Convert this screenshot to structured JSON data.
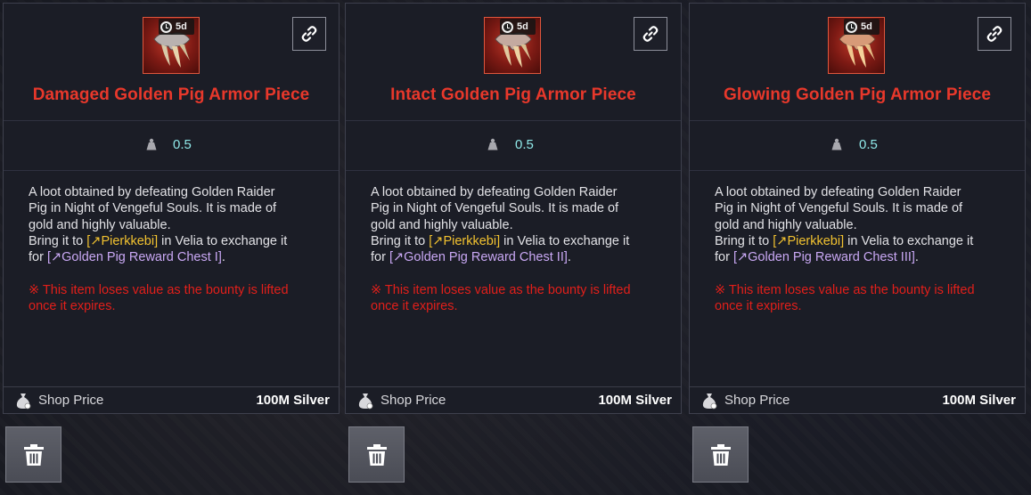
{
  "items": [
    {
      "timer": "5d",
      "title": "Damaged Golden Pig Armor Piece",
      "weight": "0.5",
      "desc_line1": "A loot obtained by defeating Golden Raider",
      "desc_line2": "Pig in Night of Vengeful Souls. It is made of",
      "desc_line3": "gold and highly valuable.",
      "desc_bring_prefix": "Bring it to ",
      "npc_name": "[↗Pierkkebi]",
      "desc_bring_suffix": " in Velia to exchange it",
      "desc_for": "for ",
      "reward_name": "[↗Golden Pig Reward Chest I]",
      "desc_end": ".",
      "warning_line1": "※ This item loses value as the bounty is lifted",
      "warning_line2": "once it expires.",
      "price_label": "Shop Price",
      "price_value": "100M Silver"
    },
    {
      "timer": "5d",
      "title": "Intact Golden Pig Armor Piece",
      "weight": "0.5",
      "desc_line1": "A loot obtained by defeating Golden Raider",
      "desc_line2": "Pig in Night of Vengeful Souls. It is made of",
      "desc_line3": "gold and highly valuable.",
      "desc_bring_prefix": "Bring it to ",
      "npc_name": "[↗Pierkkebi]",
      "desc_bring_suffix": " in Velia to exchange it",
      "desc_for": "for ",
      "reward_name": "[↗Golden Pig Reward Chest II]",
      "desc_end": ".",
      "warning_line1": "※ This item loses value as the bounty is lifted",
      "warning_line2": "once it expires.",
      "price_label": "Shop Price",
      "price_value": "100M Silver"
    },
    {
      "timer": "5d",
      "title": "Glowing Golden Pig Armor Piece",
      "weight": "0.5",
      "desc_line1": "A loot obtained by defeating Golden Raider",
      "desc_line2": "Pig in Night of Vengeful Souls. It is made of",
      "desc_line3": "gold and highly valuable.",
      "desc_bring_prefix": "Bring it to ",
      "npc_name": "[↗Pierkkebi]",
      "desc_bring_suffix": " in Velia to exchange it",
      "desc_for": "for ",
      "reward_name": "[↗Golden Pig Reward Chest III]",
      "desc_end": ".",
      "warning_line1": "※ This item loses value as the bounty is lifted",
      "warning_line2": "once it expires.",
      "price_label": "Shop Price",
      "price_value": "100M Silver"
    }
  ],
  "icons": {
    "item": "golden-pig-armor-piece-icon",
    "timer": "clock-icon",
    "link": "link-icon",
    "weight": "weight-icon",
    "price": "silver-bag-icon",
    "delete": "trash-icon"
  },
  "colors": {
    "title": "#e8382b",
    "weight": "#8fe8e8",
    "npc_link": "#f2c230",
    "reward_link": "#c9a8f4",
    "warning": "#e21f1a"
  }
}
